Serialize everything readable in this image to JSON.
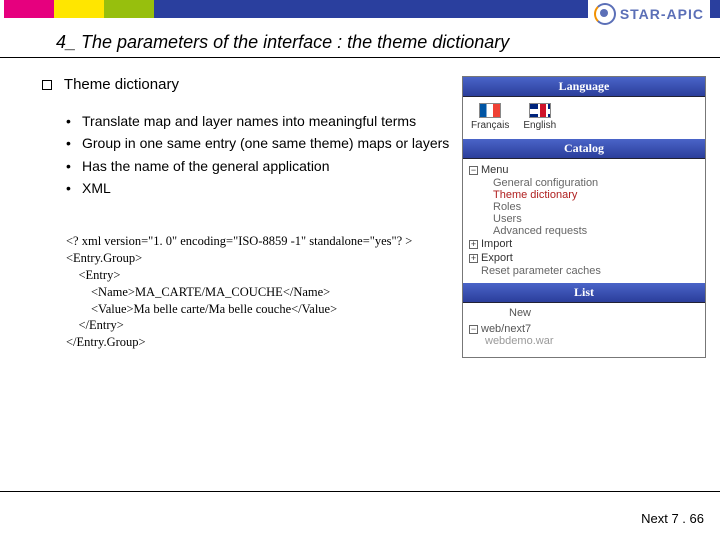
{
  "logo_text": "STAR-APIC",
  "slide_title": "4_ The parameters of the interface : the theme dictionary",
  "section_heading": "Theme dictionary",
  "bullets": [
    "Translate map and layer names into meaningful terms",
    "Group in one same entry (one same theme) maps or layers",
    "Has the name of the general application",
    "XML"
  ],
  "xml_lines": [
    "<? xml version=\"1. 0\" encoding=\"ISO-8859 -1\" standalone=\"yes\"? >",
    "<Entry.Group>",
    "    <Entry>",
    "        <Name>MA_CARTE/MA_COUCHE</Name>",
    "        <Value>Ma belle carte/Ma belle couche</Value>",
    "    </Entry>",
    "</Entry.Group>"
  ],
  "panel": {
    "language_header": "Language",
    "lang_fr": "Français",
    "lang_en": "English",
    "catalog_header": "Catalog",
    "tree": {
      "root": "Menu",
      "items": [
        "General configuration",
        "Theme dictionary",
        "Roles",
        "Users",
        "Advanced requests"
      ],
      "import": "Import",
      "export": "Export",
      "reset": "Reset parameter caches"
    },
    "list_header": "List",
    "list_root": "New",
    "list_node": "web/next7",
    "list_leaf": "webdemo.war"
  },
  "footer": "Next 7 . 66"
}
